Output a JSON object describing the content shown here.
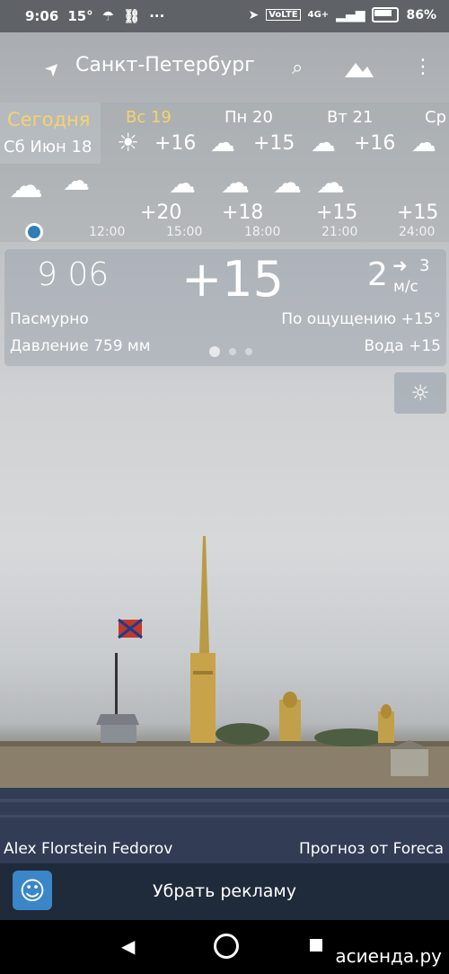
{
  "status": {
    "time": "9:06",
    "temp": "15°",
    "more": "···",
    "network": "4G+",
    "battery": "86%"
  },
  "toolbar": {
    "city": "Санкт-Петербург"
  },
  "days": [
    {
      "label": "Сегодня",
      "date": "Сб Июн 18",
      "temp": ""
    },
    {
      "label": "Вс 19",
      "temp": "+16"
    },
    {
      "label": "Пн 20",
      "temp": "+15"
    },
    {
      "label": "Вт 21",
      "temp": "+16"
    },
    {
      "label": "Ср",
      "temp": ""
    }
  ],
  "hourly": [
    {
      "time": "12:00",
      "temp": "+20"
    },
    {
      "time": "15:00",
      "temp": "+18"
    },
    {
      "time": "18:00",
      "temp": "+15"
    },
    {
      "time": "21:00",
      "temp": "+15"
    },
    {
      "time": "24:00",
      "temp": ""
    }
  ],
  "current": {
    "time": "9 06",
    "temp": "+15",
    "wind_speed": "2",
    "wind_dir_value": "3",
    "wind_unit": "м/с",
    "condition": "Пасмурно",
    "feels_like": "По ощущению +15°",
    "pressure": "Давление 759 мм",
    "water": "Вода +15"
  },
  "footer": {
    "photo_author": "Alex Florstein Fedorov",
    "source": "Прогноз от Foreca"
  },
  "ad": {
    "label": "Убрать рекламу"
  },
  "watermark": {
    "text": "асиенда.ру"
  }
}
